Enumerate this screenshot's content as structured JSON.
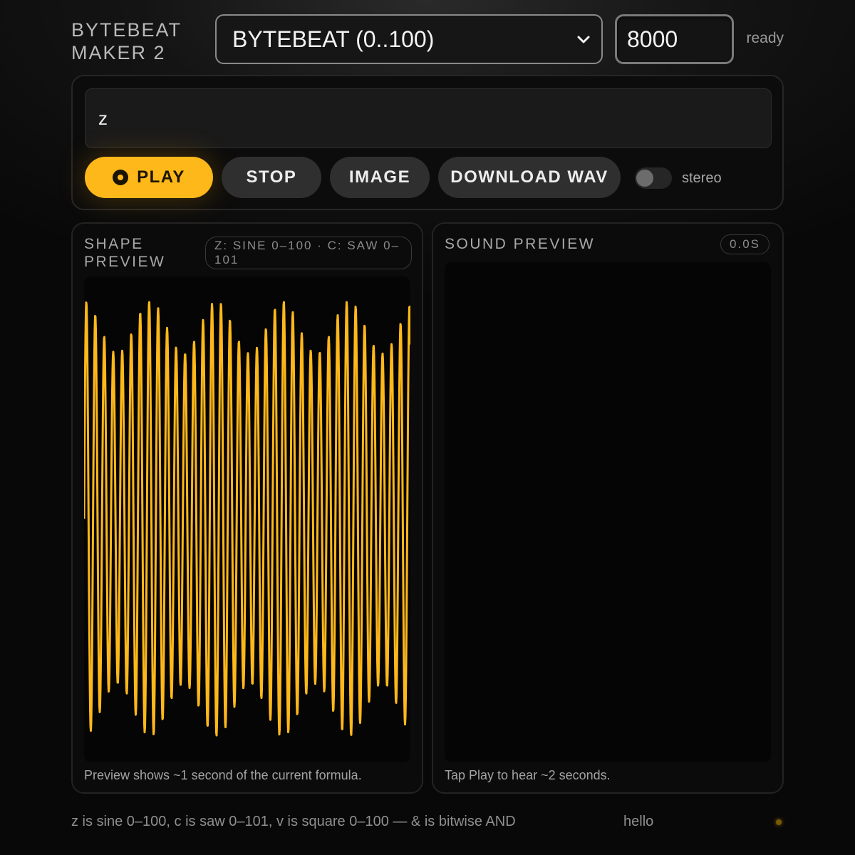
{
  "header": {
    "app_title": "BYTEBEAT\nMAKER 2",
    "mode_select_value": "BYTEBEAT (0..100)",
    "sample_rate": "8000",
    "status": "ready"
  },
  "editor": {
    "formula": "z",
    "buttons": {
      "play": "PLAY",
      "stop": "STOP",
      "image": "IMAGE",
      "download_wav": "DOWNLOAD WAV"
    },
    "stereo_label": "stereo",
    "stereo_on": false
  },
  "shape_preview": {
    "title": "SHAPE\nPREVIEW",
    "badge": "Z: SINE 0–100 · C: SAW 0–101",
    "note": "Preview shows ~1 second of the current formula.",
    "wave_color": "#ffb81a"
  },
  "sound_preview": {
    "title": "SOUND PREVIEW",
    "badge": "0.0S",
    "note": "Tap Play to hear ~2 seconds."
  },
  "footer": {
    "help": "z is sine 0–100, c is saw 0–101, v is square 0–100 — & is bitwise AND",
    "extra": "hello"
  },
  "colors": {
    "accent": "#ffb81a",
    "background": "#0b0b0b"
  }
}
